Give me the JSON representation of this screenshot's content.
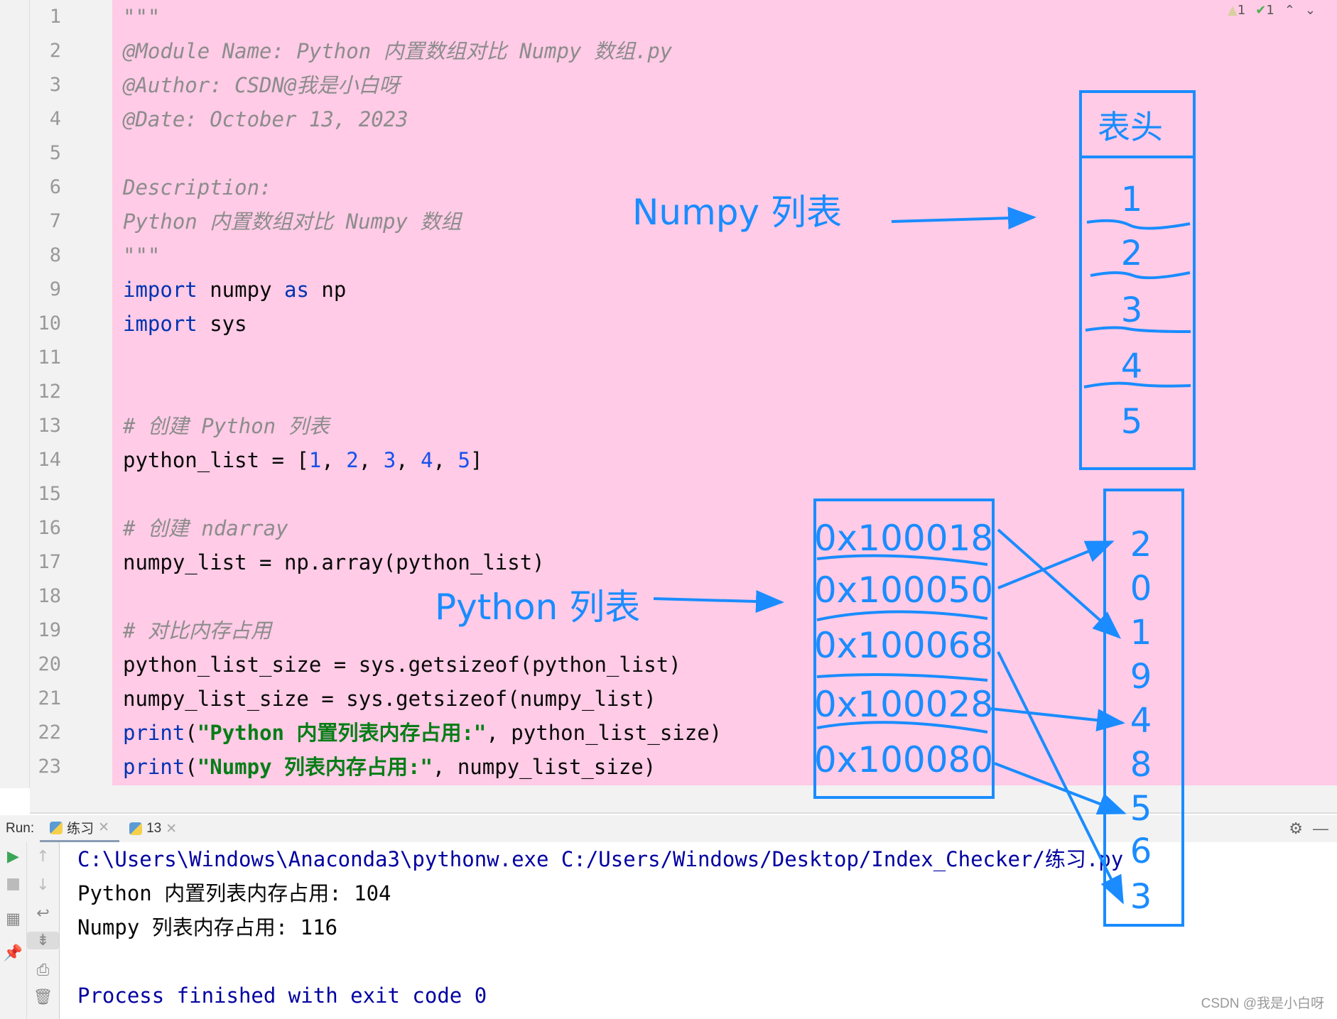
{
  "editor": {
    "lines": [
      [
        [
          "\"\"\"",
          "doc"
        ]
      ],
      [
        [
          "@Module Name: Python 内置数组对比 Numpy 数组.py",
          "doc"
        ]
      ],
      [
        [
          "@Author: CSDN@我是小白呀",
          "doc"
        ]
      ],
      [
        [
          "@Date: October 13, 2023",
          "doc"
        ]
      ],
      [],
      [
        [
          "Description:",
          "doc"
        ]
      ],
      [
        [
          "Python 内置数组对比 Numpy 数组",
          "doc"
        ]
      ],
      [
        [
          "\"\"\"",
          "doc"
        ]
      ],
      [
        [
          "import",
          "kw"
        ],
        [
          " numpy ",
          ""
        ],
        [
          "as",
          "kw"
        ],
        [
          " np",
          ""
        ]
      ],
      [
        [
          "import",
          "kw"
        ],
        [
          " sys",
          ""
        ]
      ],
      [],
      [],
      [
        [
          "# 创建 Python 列表",
          "cm"
        ]
      ],
      [
        [
          "python_list = [",
          ""
        ],
        [
          "1",
          "num"
        ],
        [
          ", ",
          ""
        ],
        [
          "2",
          "num"
        ],
        [
          ", ",
          ""
        ],
        [
          "3",
          "num"
        ],
        [
          ", ",
          ""
        ],
        [
          "4",
          "num"
        ],
        [
          ", ",
          ""
        ],
        [
          "5",
          "num"
        ],
        [
          "]",
          ""
        ]
      ],
      [],
      [
        [
          "# 创建 ndarray",
          "cm"
        ]
      ],
      [
        [
          "numpy_list = np.array(python_list)",
          ""
        ]
      ],
      [],
      [
        [
          "# 对比内存占用",
          "cm"
        ]
      ],
      [
        [
          "python_list_size = sys.getsizeof(python_list)",
          ""
        ]
      ],
      [
        [
          "numpy_list_size = sys.getsizeof(numpy_list)",
          ""
        ]
      ],
      [
        [
          "print",
          "kw"
        ],
        [
          "(",
          ""
        ],
        [
          "\"Python 内置列表内存占用:\"",
          "str"
        ],
        [
          ", python_list_size)",
          ""
        ]
      ],
      [
        [
          "print",
          "kw"
        ],
        [
          "(",
          ""
        ],
        [
          "\"Numpy 列表内存占用:\"",
          "str"
        ],
        [
          ", numpy_list_size)",
          ""
        ]
      ]
    ],
    "status": {
      "warnings": "1",
      "checks": "1"
    }
  },
  "run": {
    "label": "Run:",
    "tabs": [
      {
        "label": "练习"
      },
      {
        "label": "13"
      }
    ]
  },
  "console": [
    "C:\\Users\\Windows\\Anaconda3\\pythonw.exe C:/Users/Windows/Desktop/Index_Checker/练习.py",
    "Python 内置列表内存占用: 104",
    "Numpy 列表内存占用: 116",
    "",
    "Process finished with exit code 0"
  ],
  "annotation": {
    "color": "#1a8cff",
    "numpy_label": "Numpy 列表",
    "python_label": "Python 列表",
    "header": "表头",
    "numpy_values": [
      "1",
      "2",
      "3",
      "4",
      "5"
    ],
    "addresses": [
      "0x100018",
      "0x100050",
      "0x100068",
      "0x100028",
      "0x100080"
    ],
    "memory": [
      "2",
      "0",
      "1",
      "9",
      "4",
      "8",
      "5",
      "6",
      "3"
    ]
  },
  "watermark": "CSDN @我是小白呀"
}
